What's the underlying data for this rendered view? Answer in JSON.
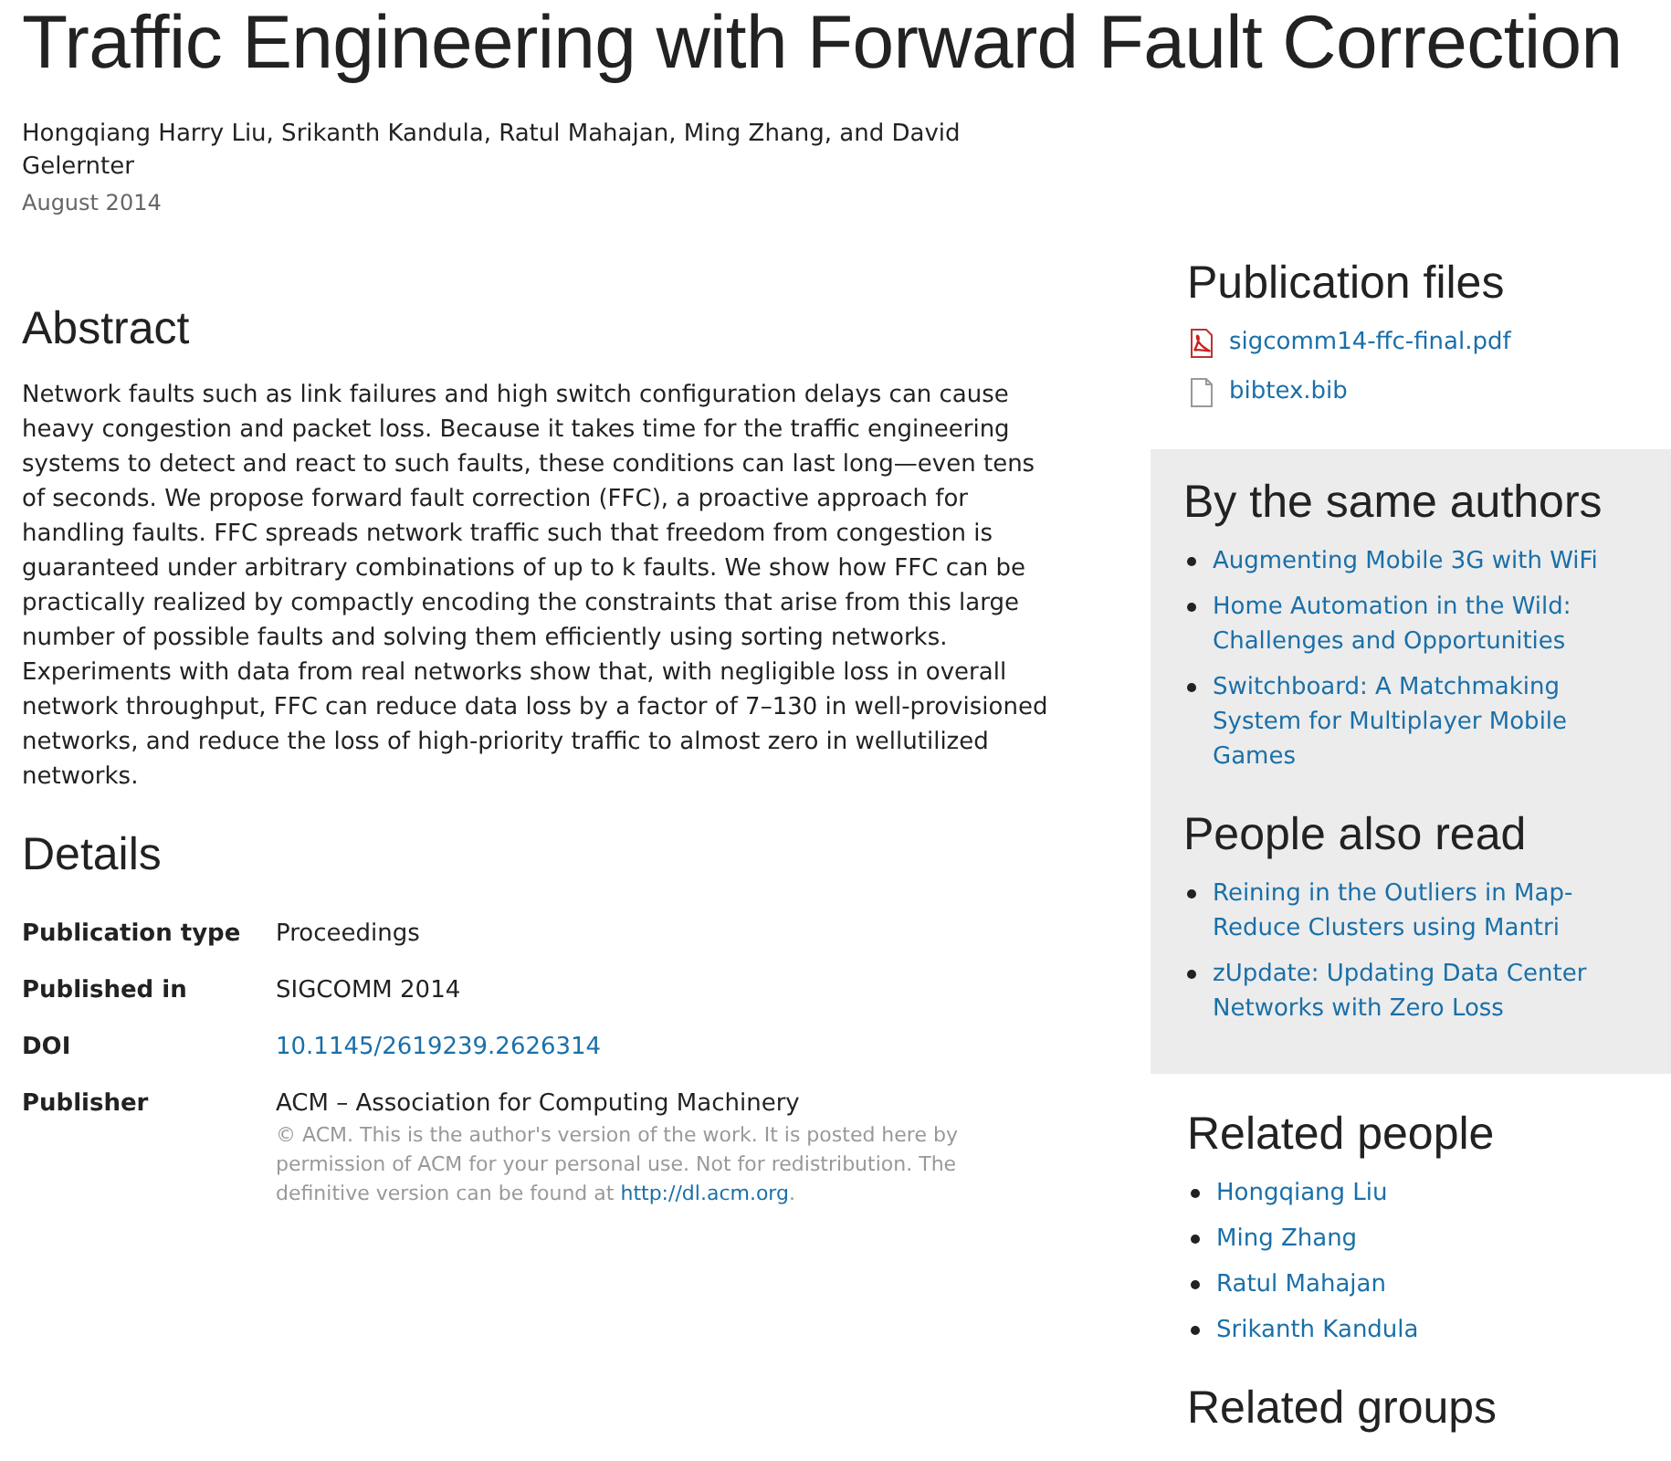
{
  "title": "Traffic Engineering with Forward Fault Correction",
  "authors": "Hongqiang Harry Liu, Srikanth Kandula, Ratul Mahajan, Ming Zhang, and David Gelernter",
  "date": "August 2014",
  "abstract": {
    "heading": "Abstract",
    "text": "Network faults such as link failures and high switch configuration delays can cause heavy congestion and packet loss. Because it takes time for the traffic engineering systems to detect and react to such faults, these conditions can last long—even tens of seconds. We propose forward fault correction (FFC), a proactive approach for handling faults. FFC spreads network traffic such that freedom from congestion is guaranteed under arbitrary combinations of up to k faults. We show how FFC can be practically realized by compactly encoding the constraints that arise from this large number of possible faults and solving them efficiently using sorting networks. Experiments with data from real networks show that, with negligible loss in overall network throughput, FFC can reduce data loss by a factor of 7–130 in well-provisioned networks, and reduce the loss of high-priority traffic to almost zero in wellutilized networks."
  },
  "details": {
    "heading": "Details",
    "rows": [
      {
        "label": "Publication type",
        "value": "Proceedings",
        "kind": "text"
      },
      {
        "label": "Published in",
        "value": "SIGCOMM 2014",
        "kind": "text"
      },
      {
        "label": "DOI",
        "value": "10.1145/2619239.2626314",
        "kind": "link"
      },
      {
        "label": "Publisher",
        "value": "ACM – Association for Computing Machinery",
        "kind": "text",
        "note": {
          "text": "© ACM. This is the author's version of the work. It is posted here by permission of ACM for your personal use. Not for redistribution. The definitive version can be found at ",
          "link": "http://dl.acm.org",
          "after": "."
        }
      }
    ]
  },
  "publication_files": {
    "heading": "Publication files",
    "files": [
      {
        "name": "sigcomm14-ffc-final.pdf",
        "kind": "pdf"
      },
      {
        "name": "bibtex.bib",
        "kind": "file"
      }
    ]
  },
  "same_authors": {
    "heading": "By the same authors",
    "items": [
      "Augmenting Mobile 3G with WiFi",
      "Home Automation in the Wild: Challenges and Opportunities",
      "Switchboard: A Matchmaking System for Multiplayer Mobile Games"
    ]
  },
  "also_read": {
    "heading": "People also read",
    "items": [
      "Reining in the Outliers in Map-Reduce Clusters using Mantri",
      "zUpdate: Updating Data Center Networks with Zero Loss"
    ]
  },
  "related_people": {
    "heading": "Related people",
    "items": [
      "Hongqiang Liu",
      "Ming Zhang",
      "Ratul Mahajan",
      "Srikanth Kandula"
    ]
  },
  "related_groups": {
    "heading": "Related groups"
  }
}
